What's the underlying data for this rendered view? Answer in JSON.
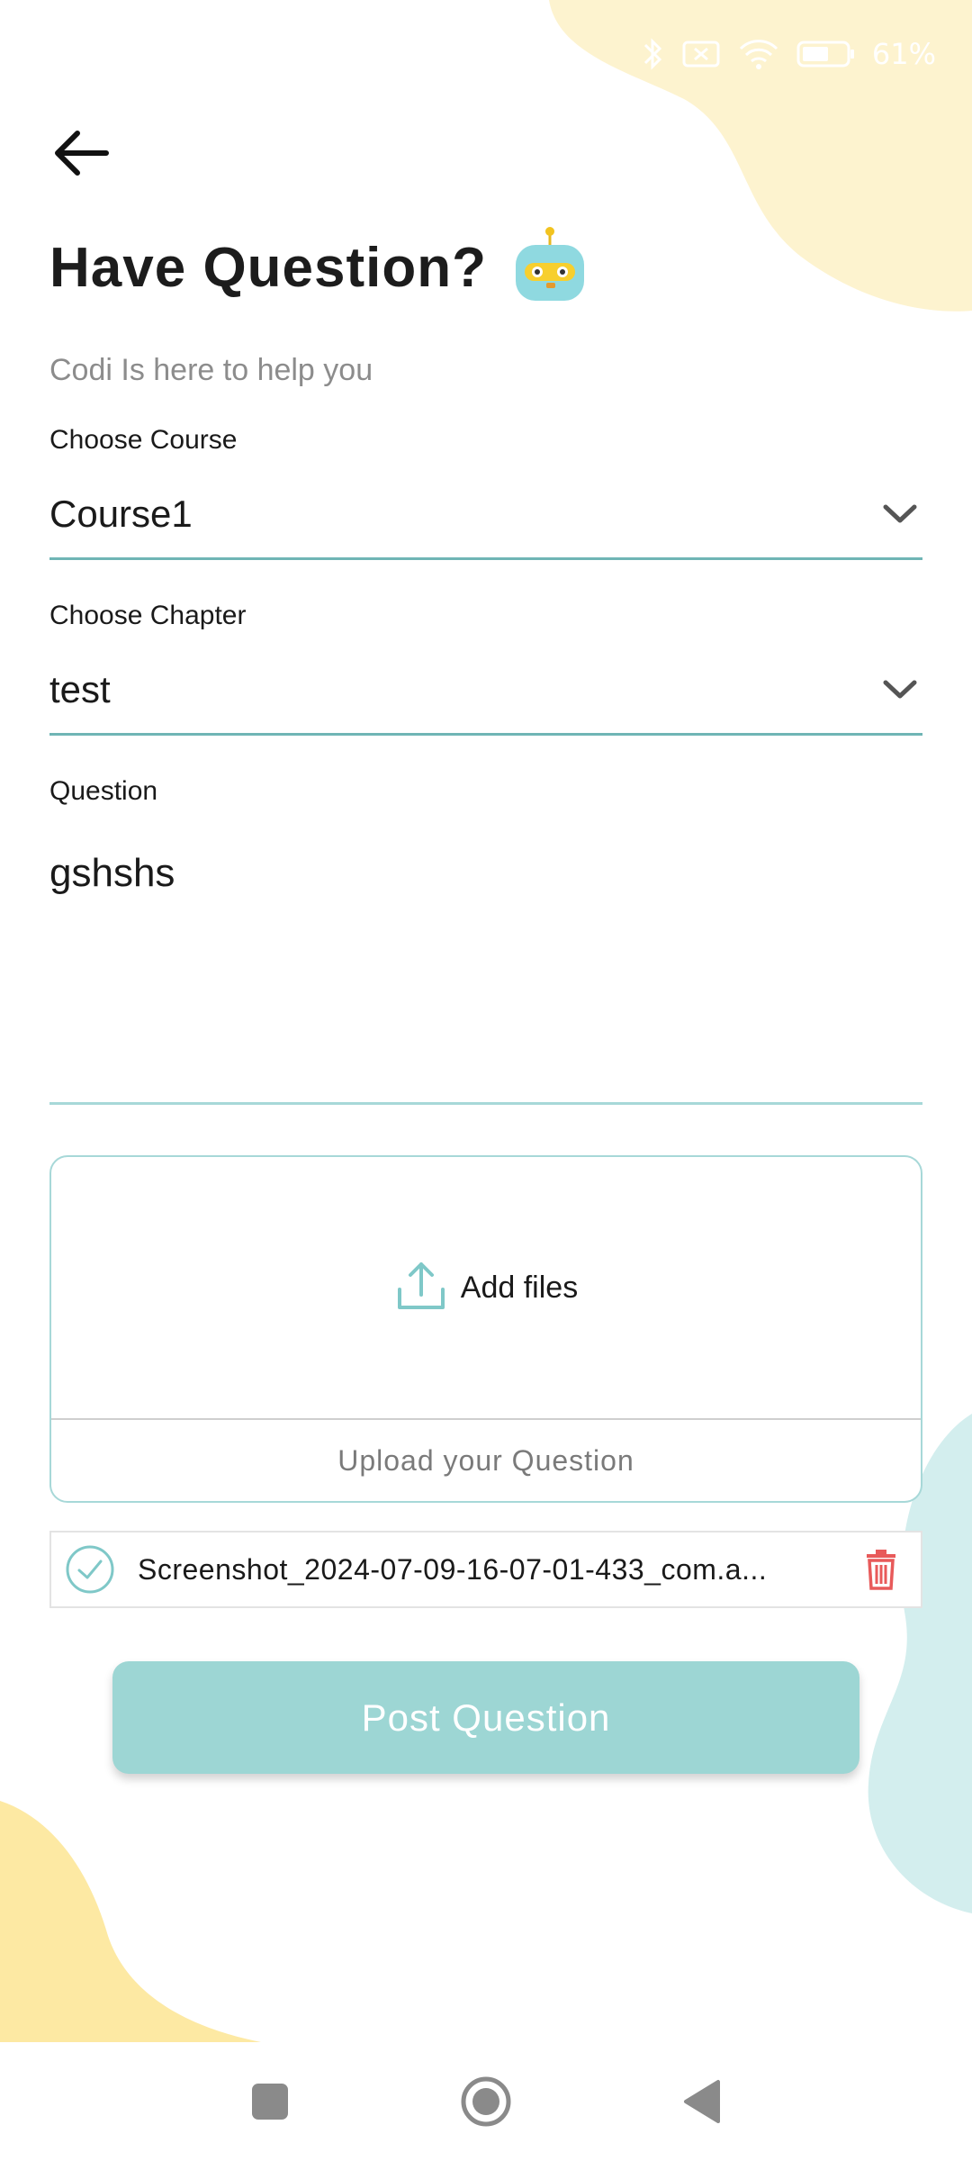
{
  "status_bar": {
    "battery_text": "61%",
    "icons": [
      "bluetooth-icon",
      "no-sim-icon",
      "wifi-icon",
      "battery-icon"
    ]
  },
  "header": {
    "title": "Have Question?",
    "subtitle": "Codi Is here to help you",
    "mascot_icon": "robot-mascot-icon"
  },
  "form": {
    "course": {
      "label": "Choose Course",
      "value": "Course1"
    },
    "chapter": {
      "label": "Choose Chapter",
      "value": "test"
    },
    "question": {
      "label": "Question",
      "value": "gshshs"
    }
  },
  "upload": {
    "add_files_label": "Add files",
    "footer_label": "Upload your Question"
  },
  "attachment": {
    "file_name": "Screenshot_2024-07-09-16-07-01-433_com.a..."
  },
  "actions": {
    "post_label": "Post Question"
  },
  "colors": {
    "accent": "#9dd6d4",
    "underline": "#6fb5b5",
    "delete": "#e85a5a",
    "blob_yellow": "#fdf3cf",
    "blob_teal": "#d3eeee"
  }
}
